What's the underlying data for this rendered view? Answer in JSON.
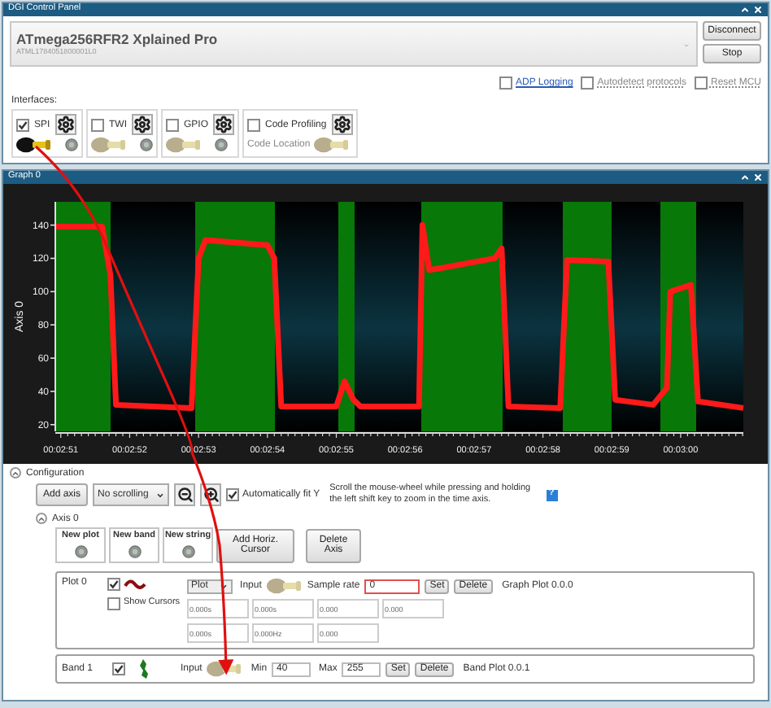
{
  "dgi_panel": {
    "title": "DGI Control Panel",
    "device": {
      "name": "ATmega256RFR2 Xplained Pro",
      "serial": "ATML1784051800001L0"
    },
    "buttons": [
      "Disconnect",
      "Stop"
    ],
    "options": [
      {
        "label": "ADP Logging",
        "checked": false,
        "kind": "link"
      },
      {
        "label": "Autodetect protocols",
        "checked": false,
        "kind": "plain"
      },
      {
        "label": "Reset MCU",
        "checked": false,
        "kind": "plain"
      }
    ],
    "interfaces_label": "Interfaces:",
    "interfaces": [
      {
        "kind": "interface",
        "label": "SPI",
        "checked": true,
        "on": true
      },
      {
        "kind": "interface",
        "label": "TWI",
        "checked": false,
        "on": false
      },
      {
        "kind": "interface",
        "label": "GPIO",
        "checked": false,
        "on": false
      },
      {
        "kind": "profiling",
        "label": "Code Profiling",
        "checked": false,
        "on": false,
        "sub_label": "Code Location"
      }
    ]
  },
  "graph": {
    "title": "Graph 0",
    "chart_data": {
      "type": "line",
      "ylabel": "Axis 0",
      "x": [
        170.92,
        171.6,
        171.72,
        171.8,
        172.9,
        173.0,
        173.1,
        174.0,
        174.1,
        174.2,
        175.0,
        175.12,
        175.25,
        175.35,
        176.2,
        176.25,
        176.35,
        176.5,
        177.3,
        177.4,
        177.5,
        178.25,
        178.35,
        178.95,
        179.05,
        179.6,
        179.8,
        179.85,
        180.15,
        180.25,
        180.91
      ],
      "series": [
        {
          "color": "#ff1a1a",
          "values": [
            139,
            139,
            110,
            32,
            30,
            120,
            131,
            128,
            120,
            31,
            31,
            46,
            35,
            31,
            31,
            140,
            113,
            114,
            120,
            126,
            31,
            30,
            119,
            118,
            35,
            32,
            42,
            100,
            104,
            34,
            30
          ]
        }
      ],
      "xlim": [
        170.92,
        180.91
      ],
      "ylim": [
        16,
        154
      ],
      "xticks": [
        {
          "value": 171,
          "label": "00:02:51"
        },
        {
          "value": 172,
          "label": "00:02:52"
        },
        {
          "value": 173,
          "label": "00:02:53"
        },
        {
          "value": 174,
          "label": "00:02:54"
        },
        {
          "value": 175,
          "label": "00:02:55"
        },
        {
          "value": 176,
          "label": "00:02:56"
        },
        {
          "value": 177,
          "label": "00:02:57"
        },
        {
          "value": 178,
          "label": "00:02:58"
        },
        {
          "value": 179,
          "label": "00:02:59"
        },
        {
          "value": 180,
          "label": "00:03:00"
        }
      ],
      "yticks": [
        20,
        40,
        60,
        80,
        100,
        120,
        140
      ]
    },
    "configuration": {
      "label": "Configuration",
      "expanded": true,
      "add_axis": "Add axis",
      "scroll_mode": "No scrolling",
      "auto_fit": {
        "label": "Automatically fit Y",
        "checked": true
      },
      "hint": "Scroll the mouse-wheel while pressing and holding the left shift key to zoom in the time axis.",
      "help": "?"
    },
    "axis": {
      "label": "Axis 0",
      "expanded": true,
      "new_buttons": [
        "New plot",
        "New band",
        "New string"
      ],
      "actions": [
        "Add Horiz. Cursor",
        "Delete Axis"
      ]
    },
    "plots": [
      {
        "kind": "plot",
        "name": "Plot 0",
        "enabled": true,
        "type": "Plot",
        "input_label": "Input",
        "sample_rate_label": "Sample rate",
        "sample_rate": "0",
        "set": "Set",
        "delete": "Delete",
        "caption": "Graph Plot 0.0.0",
        "show_cursors": {
          "label": "Show Cursors",
          "checked": false
        },
        "cursor_fields": [
          [
            "0.000s",
            "0.000s",
            "0.000",
            "0.000"
          ],
          [
            "0.000s",
            "0.000Hz",
            "0.000"
          ]
        ]
      },
      {
        "kind": "band",
        "name": "Band 1",
        "enabled": true,
        "input_label": "Input",
        "min_label": "Min",
        "min": "40",
        "max_label": "Max",
        "max": "255",
        "set": "Set",
        "delete": "Delete",
        "caption": "Band Plot 0.0.1"
      }
    ]
  },
  "annotation_arrow": {
    "color": "#e01010"
  }
}
